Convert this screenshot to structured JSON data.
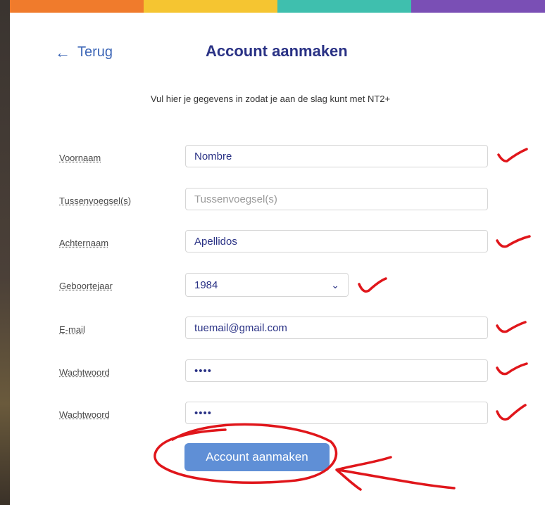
{
  "header": {
    "back_label": "Terug",
    "title": "Account aanmaken",
    "subtitle": "Vul hier je gegevens in zodat je aan de slag kunt met NT2+"
  },
  "form": {
    "first_name": {
      "label": "Voornaam",
      "value": "Nombre"
    },
    "infix": {
      "label": "Tussenvoegsel(s)",
      "value": "",
      "placeholder": "Tussenvoegsel(s)"
    },
    "last_name": {
      "label": "Achternaam",
      "value": "Apellidos"
    },
    "birth_year": {
      "label": "Geboortejaar",
      "value": "1984"
    },
    "email": {
      "label": "E-mail",
      "value": "tuemail@gmail.com"
    },
    "password": {
      "label": "Wachtwoord",
      "value": "••••"
    },
    "password_confirm": {
      "label": "Wachtwoord",
      "value": "••••"
    },
    "submit_label": "Account aanmaken"
  },
  "colors": {
    "stripe": [
      "#f07b2c",
      "#f5c531",
      "#3fbfae",
      "#7a4fb5"
    ],
    "title": "#2a3285",
    "link": "#3e67b7",
    "button": "#5f8fd6",
    "annotation": "#e0161b"
  },
  "icons": {
    "back": "arrow-left-icon",
    "select": "chevron-down-icon"
  }
}
